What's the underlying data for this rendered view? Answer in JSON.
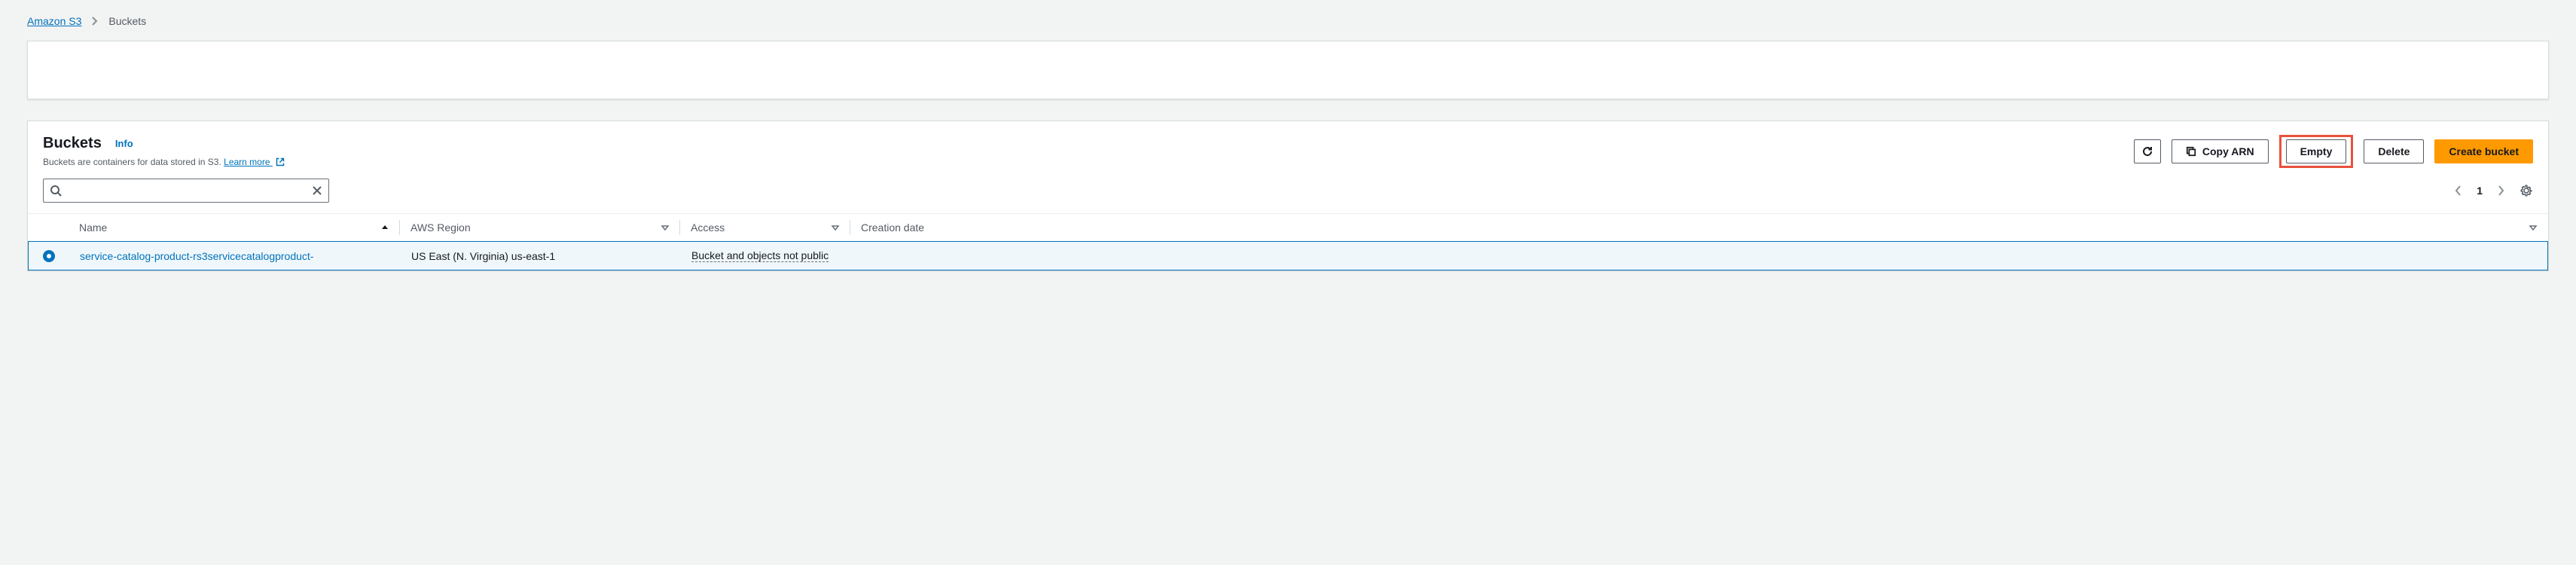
{
  "breadcrumbs": {
    "root": "Amazon S3",
    "current": "Buckets"
  },
  "header": {
    "title": "Buckets",
    "info": "Info",
    "subtitle_prefix": "Buckets are containers for data stored in S3. ",
    "learn_more": "Learn more"
  },
  "actions": {
    "copy_arn": "Copy ARN",
    "empty": "Empty",
    "delete": "Delete",
    "create": "Create bucket"
  },
  "search": {
    "value": "",
    "placeholder": ""
  },
  "pagination": {
    "page": "1"
  },
  "table": {
    "columns": {
      "name": "Name",
      "region": "AWS Region",
      "access": "Access",
      "creation_date": "Creation date"
    },
    "rows": [
      {
        "name": "service-catalog-product-rs3servicecatalogproduct-",
        "region": "US East (N. Virginia) us-east-1",
        "access": "Bucket and objects not public",
        "creation_date": ""
      }
    ]
  }
}
